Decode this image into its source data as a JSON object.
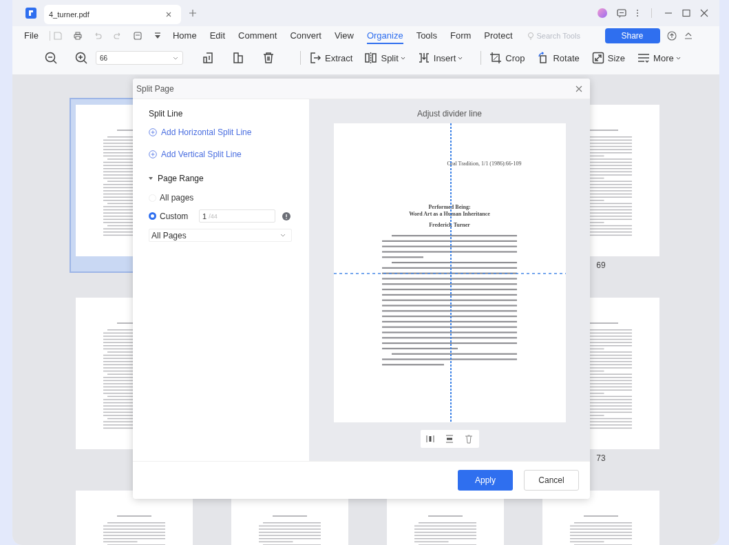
{
  "tab_bar": {
    "tabs": [
      {
        "title": "4_turner.pdf",
        "selected": true
      }
    ]
  },
  "menu_bar": {
    "items": [
      {
        "label": "File",
        "selected": false
      },
      {
        "label": "Home",
        "selected": false
      },
      {
        "label": "Edit",
        "selected": false
      },
      {
        "label": "Comment",
        "selected": false
      },
      {
        "label": "Convert",
        "selected": false
      },
      {
        "label": "View",
        "selected": false
      },
      {
        "label": "Organize",
        "selected": true
      },
      {
        "label": "Tools",
        "selected": false
      },
      {
        "label": "Form",
        "selected": false
      },
      {
        "label": "Protect",
        "selected": false
      }
    ],
    "search": {
      "placeholder": "Search Tools"
    },
    "share_button": "Share"
  },
  "toolbar": {
    "zoom": "66",
    "tools": [
      {
        "label": "Extract",
        "dropdown": false
      },
      {
        "label": "Split",
        "dropdown": true
      },
      {
        "label": "Insert",
        "dropdown": true
      },
      {
        "label": "Crop",
        "dropdown": false
      },
      {
        "label": "Rotate",
        "dropdown": false
      },
      {
        "label": "Size",
        "dropdown": false
      },
      {
        "label": "More",
        "dropdown": true
      }
    ]
  },
  "pages": [
    {
      "selected": true
    },
    {
      "label": "69",
      "selected": false
    },
    {
      "selected": false
    },
    {
      "label": "73",
      "selected": false
    },
    {
      "selected": false
    },
    {
      "selected": false
    },
    {
      "selected": false
    },
    {
      "selected": false
    }
  ],
  "dialog": {
    "title": "Split Page",
    "split_line": {
      "heading": "Split Line",
      "actions": [
        "Add Horizontal Split Line",
        "Add Vertical Split Line"
      ]
    },
    "page_range": {
      "heading": "Page Range",
      "expanded": true,
      "options": [
        {
          "label": "All pages",
          "selected": false
        },
        {
          "label": "Custom",
          "selected": true
        }
      ],
      "custom_value": "1",
      "custom_total": "/44",
      "subset": "All Pages"
    },
    "preview": {
      "heading": "Adjust divider line",
      "document": {
        "header": "Oral Tradition, 1/1 (1986):66-109",
        "title": [
          "Performed Being:",
          "Word Art as a Human Inheritance"
        ],
        "author": "Frederick Turner"
      }
    },
    "buttons": [
      {
        "label": "Apply",
        "kind": "primary"
      },
      {
        "label": "Cancel",
        "kind": "secondary"
      }
    ]
  }
}
